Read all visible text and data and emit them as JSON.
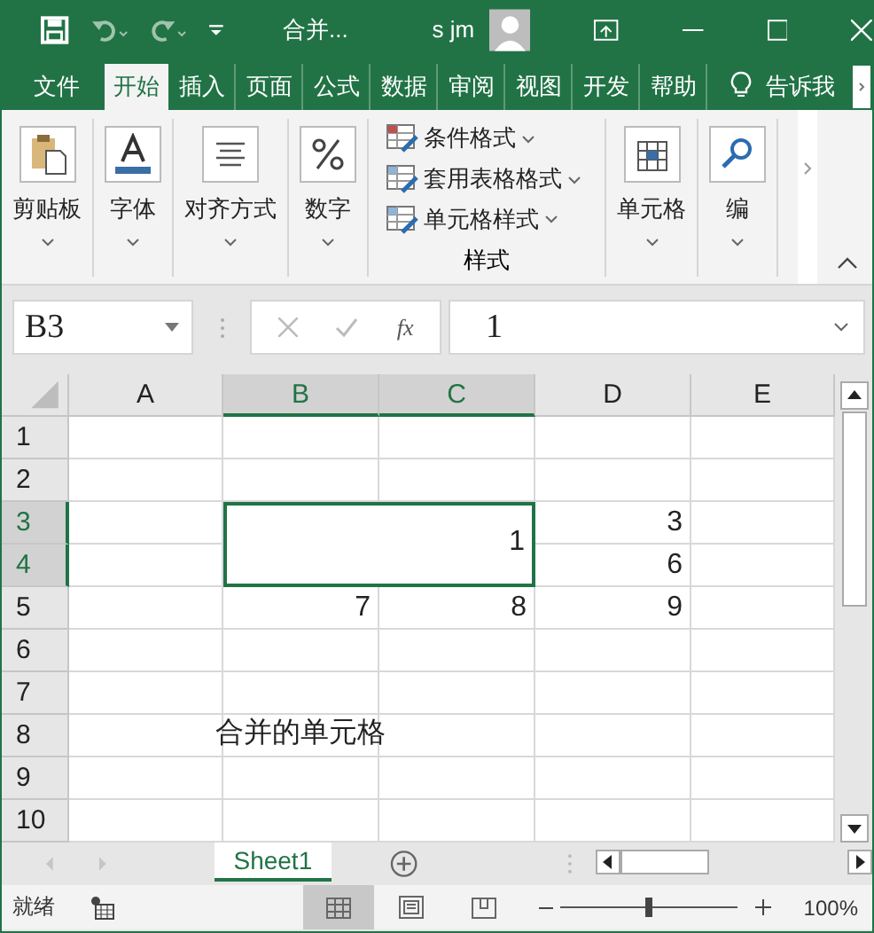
{
  "window": {
    "title": "合并...",
    "user": "s jm"
  },
  "ribbon_tabs": [
    {
      "label": "文件",
      "selected": false
    },
    {
      "label": "开始",
      "selected": true
    },
    {
      "label": "插入",
      "selected": false
    },
    {
      "label": "页面",
      "selected": false
    },
    {
      "label": "公式",
      "selected": false
    },
    {
      "label": "数据",
      "selected": false
    },
    {
      "label": "审阅",
      "selected": false
    },
    {
      "label": "视图",
      "selected": false
    },
    {
      "label": "开发",
      "selected": false
    },
    {
      "label": "帮助",
      "selected": false
    }
  ],
  "tell_me": "告诉我",
  "ribbon_groups": [
    {
      "kind": "big",
      "label": "剪贴板"
    },
    {
      "kind": "big",
      "label": "字体"
    },
    {
      "kind": "big",
      "label": "对齐方式"
    },
    {
      "kind": "big",
      "label": "数字"
    },
    {
      "kind": "styles",
      "label": "样式",
      "items": [
        "条件格式",
        "套用表格格式",
        "单元格样式"
      ]
    },
    {
      "kind": "big",
      "label": "单元格"
    },
    {
      "kind": "big",
      "label": "编"
    }
  ],
  "formula_bar": {
    "name_box": "B3",
    "function_label": "fx",
    "value": "1"
  },
  "sheet": {
    "columns": [
      {
        "label": "A",
        "selected": false
      },
      {
        "label": "B",
        "selected": true
      },
      {
        "label": "C",
        "selected": true
      },
      {
        "label": "D",
        "selected": false
      },
      {
        "label": "E",
        "selected": false
      }
    ],
    "rows": [
      {
        "label": "1",
        "selected": false,
        "cells": [
          {
            "selected": false
          },
          {
            "selected": false
          },
          {
            "selected": false
          },
          {
            "selected": false
          },
          {
            "selected": false
          }
        ]
      },
      {
        "label": "2",
        "selected": false,
        "cells": [
          {
            "selected": false
          },
          {
            "selected": false
          },
          {
            "selected": false
          },
          {
            "selected": false
          },
          {
            "selected": false
          }
        ]
      },
      {
        "label": "3",
        "selected": true,
        "cells": [
          {
            "selected": false
          },
          {
            "value": "1",
            "kind": "number",
            "selected": true,
            "merge_right": true,
            "merge_down": true
          },
          {},
          {
            "value": "3",
            "kind": "number",
            "selected": false
          },
          {
            "selected": false
          }
        ]
      },
      {
        "label": "4",
        "selected": true,
        "cells": [
          {
            "selected": false
          },
          {},
          {},
          {
            "value": "6",
            "kind": "number",
            "selected": false
          },
          {
            "selected": false
          }
        ]
      },
      {
        "label": "5",
        "selected": false,
        "cells": [
          {
            "selected": false
          },
          {
            "value": "7",
            "kind": "number",
            "selected": false
          },
          {
            "value": "8",
            "kind": "number",
            "selected": false
          },
          {
            "value": "9",
            "kind": "number",
            "selected": false
          },
          {
            "selected": false
          }
        ]
      },
      {
        "label": "6",
        "selected": false,
        "cells": [
          {
            "selected": false
          },
          {
            "selected": false
          },
          {
            "selected": false
          },
          {
            "selected": false
          },
          {
            "selected": false
          }
        ]
      },
      {
        "label": "7",
        "selected": false,
        "cells": [
          {
            "selected": false
          },
          {
            "selected": false
          },
          {
            "selected": false
          },
          {
            "selected": false
          },
          {
            "selected": false
          }
        ]
      },
      {
        "label": "8",
        "selected": false,
        "cells": [
          {
            "selected": false
          },
          {
            "value": "合并的单元格",
            "kind": "text",
            "selected": false
          },
          {
            "selected": false
          },
          {
            "selected": false
          },
          {
            "selected": false
          }
        ]
      },
      {
        "label": "9",
        "selected": false,
        "cells": [
          {
            "selected": false
          },
          {
            "selected": false
          },
          {
            "selected": false
          },
          {
            "selected": false
          },
          {
            "selected": false
          }
        ]
      },
      {
        "label": "10",
        "selected": false,
        "cells": [
          {
            "selected": false
          },
          {
            "selected": false
          },
          {
            "selected": false
          },
          {
            "selected": false
          },
          {
            "selected": false
          }
        ]
      }
    ]
  },
  "sheet_tabs": [
    {
      "label": "Sheet1",
      "selected": true
    }
  ],
  "status_bar": {
    "text": "就绪",
    "views": [
      {
        "kind": "normal",
        "selected": true
      },
      {
        "kind": "page_layout",
        "selected": false
      },
      {
        "kind": "page_break",
        "selected": false
      }
    ],
    "zoom": {
      "level": 0.5,
      "reading": "100%"
    }
  }
}
